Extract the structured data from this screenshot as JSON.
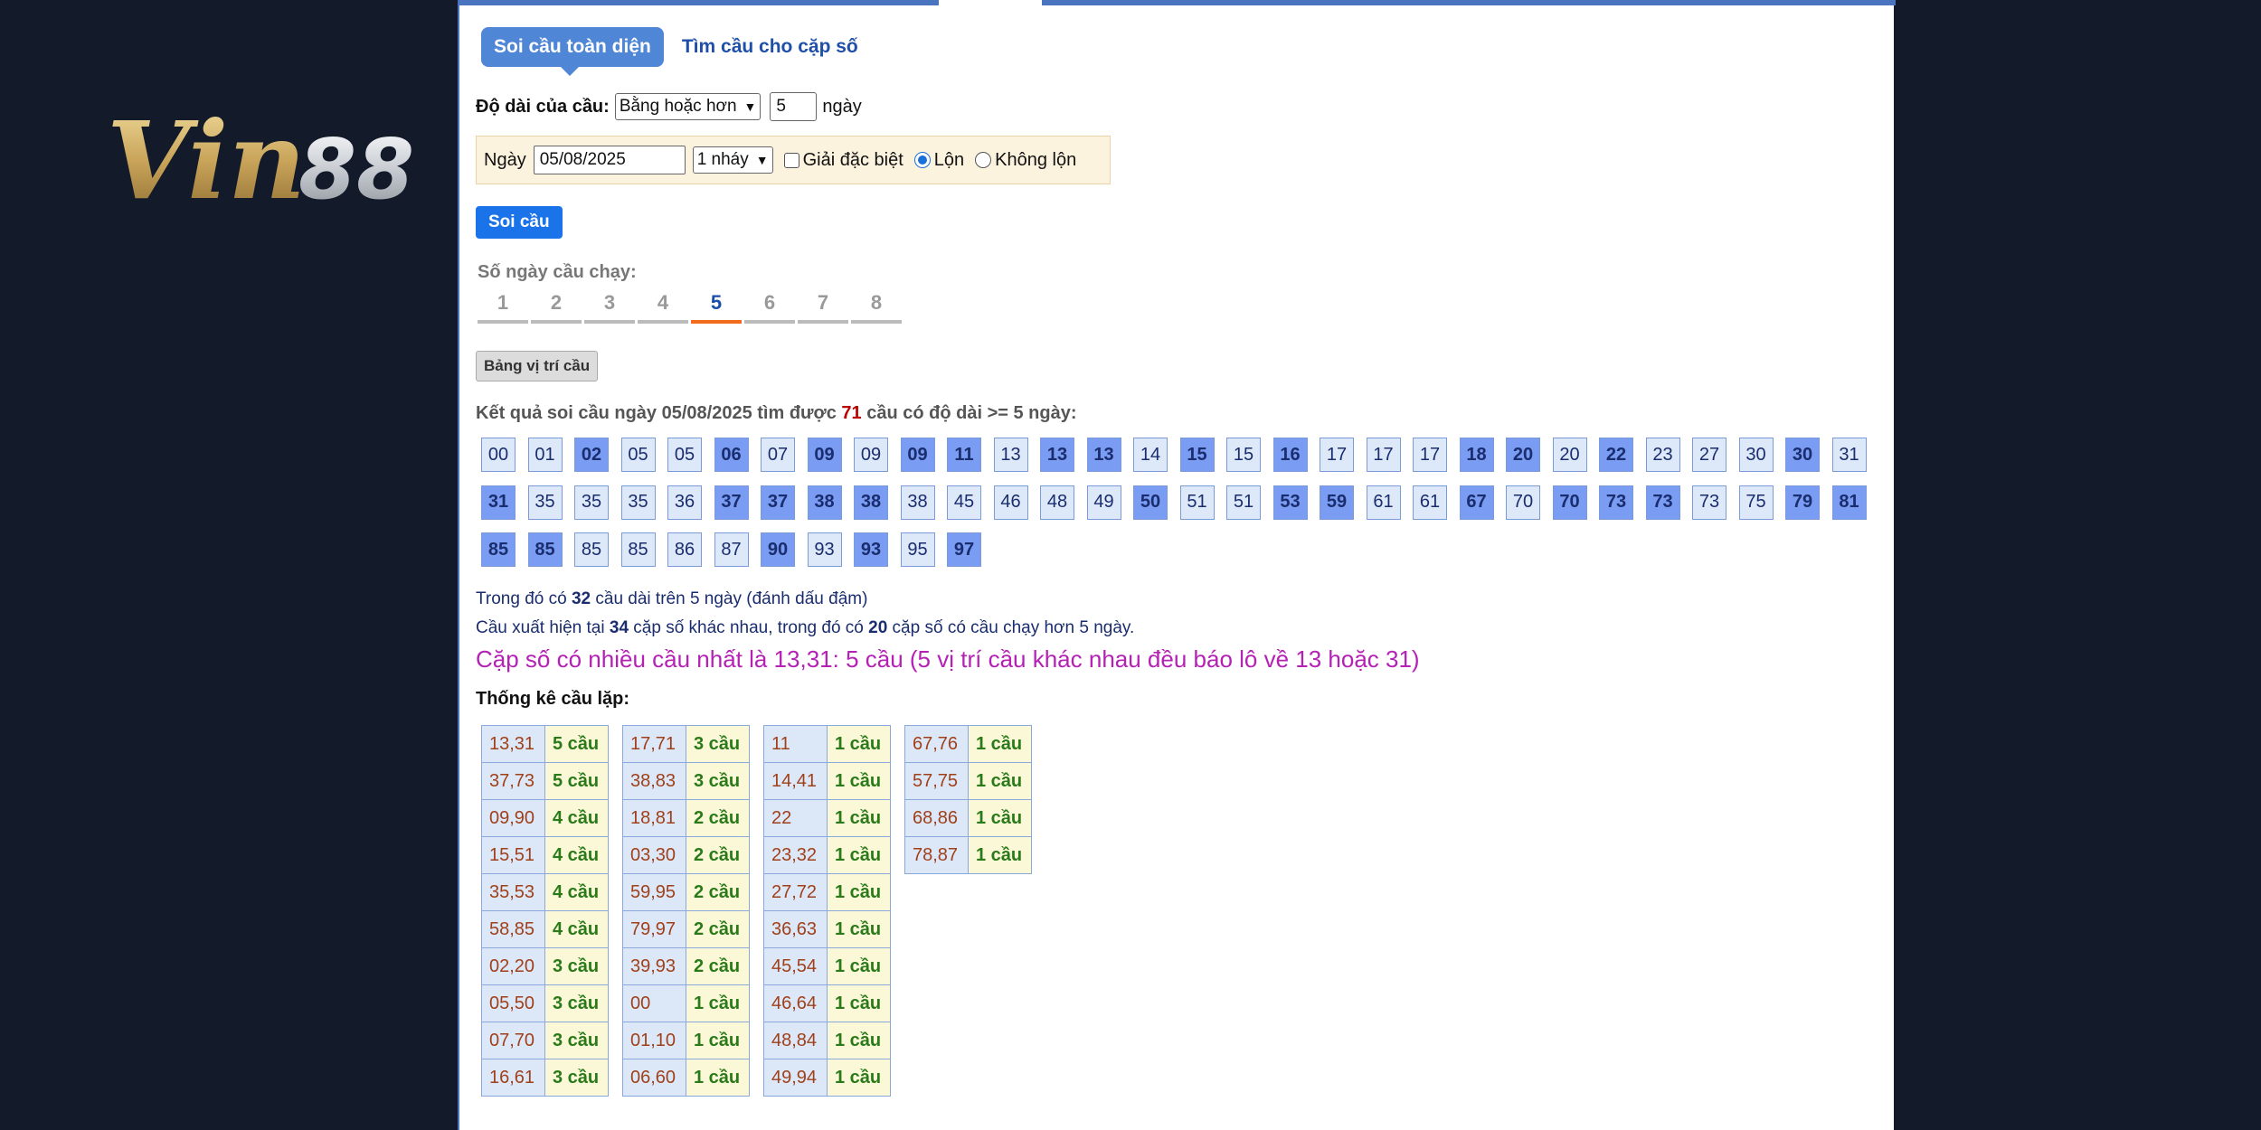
{
  "logo": {
    "text": "Vin88"
  },
  "tabs": {
    "active": "Soi cầu toàn diện",
    "other": "Tìm cầu cho cặp số"
  },
  "length_row": {
    "label": "Độ dài của cầu:",
    "select_value": "Bằng hoặc hơn",
    "days_value": "5",
    "unit": "ngày"
  },
  "filter": {
    "date_label": "Ngày",
    "date_value": "05/08/2025",
    "mode_value": "1 nháy",
    "special_label": "Giải đặc biệt",
    "lon_label": "Lộn",
    "khong_lon_label": "Không lộn"
  },
  "buttons": {
    "soi_cau": "Soi cầu",
    "bang_vi_tri": "Bảng vị trí cầu"
  },
  "days": {
    "label": "Số ngày cầu chạy:",
    "items": [
      "1",
      "2",
      "3",
      "4",
      "5",
      "6",
      "7",
      "8"
    ],
    "active": "5"
  },
  "result": {
    "prefix": "Kết quả soi cầu ngày 05/08/2025 tìm được ",
    "count": "71",
    "suffix": " cầu có độ dài >= 5 ngày:"
  },
  "numbers": [
    {
      "v": "00",
      "d": false
    },
    {
      "v": "01",
      "d": false
    },
    {
      "v": "02",
      "d": true
    },
    {
      "v": "05",
      "d": false
    },
    {
      "v": "05",
      "d": false
    },
    {
      "v": "06",
      "d": true
    },
    {
      "v": "07",
      "d": false
    },
    {
      "v": "09",
      "d": true
    },
    {
      "v": "09",
      "d": false
    },
    {
      "v": "09",
      "d": true
    },
    {
      "v": "11",
      "d": true
    },
    {
      "v": "13",
      "d": false
    },
    {
      "v": "13",
      "d": true
    },
    {
      "v": "13",
      "d": true
    },
    {
      "v": "14",
      "d": false
    },
    {
      "v": "15",
      "d": true
    },
    {
      "v": "15",
      "d": false
    },
    {
      "v": "16",
      "d": true
    },
    {
      "v": "17",
      "d": false
    },
    {
      "v": "17",
      "d": false
    },
    {
      "v": "17",
      "d": false
    },
    {
      "v": "18",
      "d": true
    },
    {
      "v": "20",
      "d": true
    },
    {
      "v": "20",
      "d": false
    },
    {
      "v": "22",
      "d": true
    },
    {
      "v": "23",
      "d": false
    },
    {
      "v": "27",
      "d": false
    },
    {
      "v": "30",
      "d": false
    },
    {
      "v": "30",
      "d": true
    },
    {
      "v": "31",
      "d": false
    },
    {
      "v": "31",
      "d": true
    },
    {
      "v": "35",
      "d": false
    },
    {
      "v": "35",
      "d": false
    },
    {
      "v": "35",
      "d": false
    },
    {
      "v": "36",
      "d": false
    },
    {
      "v": "37",
      "d": true
    },
    {
      "v": "37",
      "d": true
    },
    {
      "v": "38",
      "d": true
    },
    {
      "v": "38",
      "d": true
    },
    {
      "v": "38",
      "d": false
    },
    {
      "v": "45",
      "d": false
    },
    {
      "v": "46",
      "d": false
    },
    {
      "v": "48",
      "d": false
    },
    {
      "v": "49",
      "d": false
    },
    {
      "v": "50",
      "d": true
    },
    {
      "v": "51",
      "d": false
    },
    {
      "v": "51",
      "d": false
    },
    {
      "v": "53",
      "d": true
    },
    {
      "v": "59",
      "d": true
    },
    {
      "v": "61",
      "d": false
    },
    {
      "v": "61",
      "d": false
    },
    {
      "v": "67",
      "d": true
    },
    {
      "v": "70",
      "d": false
    },
    {
      "v": "70",
      "d": true
    },
    {
      "v": "73",
      "d": true
    },
    {
      "v": "73",
      "d": true
    },
    {
      "v": "73",
      "d": false
    },
    {
      "v": "75",
      "d": false
    },
    {
      "v": "79",
      "d": true
    },
    {
      "v": "81",
      "d": true
    },
    {
      "v": "85",
      "d": true
    },
    {
      "v": "85",
      "d": true
    },
    {
      "v": "85",
      "d": false
    },
    {
      "v": "85",
      "d": false
    },
    {
      "v": "86",
      "d": false
    },
    {
      "v": "87",
      "d": false
    },
    {
      "v": "90",
      "d": true
    },
    {
      "v": "93",
      "d": false
    },
    {
      "v": "93",
      "d": true
    },
    {
      "v": "95",
      "d": false
    },
    {
      "v": "97",
      "d": true
    }
  ],
  "info": {
    "line1_a": "Trong đó có ",
    "line1_b": "32",
    "line1_c": " cầu dài trên 5 ngày (đánh dấu đậm)",
    "line2_a": "Cầu xuất hiện tại ",
    "line2_b": "34",
    "line2_c": " cặp số khác nhau, trong đó có ",
    "line2_d": "20",
    "line2_e": " cặp số có cầu chạy hơn 5 ngày.",
    "highlight": "Cặp số có nhiều cầu nhất là 13,31: 5 cầu (5 vị trí cầu khác nhau đều báo lô về 13 hoặc 31)"
  },
  "stats": {
    "title": "Thống kê cầu lặp:",
    "columns": [
      [
        [
          "13,31",
          "5 cầu"
        ],
        [
          "37,73",
          "5 cầu"
        ],
        [
          "09,90",
          "4 cầu"
        ],
        [
          "15,51",
          "4 cầu"
        ],
        [
          "35,53",
          "4 cầu"
        ],
        [
          "58,85",
          "4 cầu"
        ],
        [
          "02,20",
          "3 cầu"
        ],
        [
          "05,50",
          "3 cầu"
        ],
        [
          "07,70",
          "3 cầu"
        ],
        [
          "16,61",
          "3 cầu"
        ]
      ],
      [
        [
          "17,71",
          "3 cầu"
        ],
        [
          "38,83",
          "3 cầu"
        ],
        [
          "18,81",
          "2 cầu"
        ],
        [
          "03,30",
          "2 cầu"
        ],
        [
          "59,95",
          "2 cầu"
        ],
        [
          "79,97",
          "2 cầu"
        ],
        [
          "39,93",
          "2 cầu"
        ],
        [
          "00",
          "1 cầu"
        ],
        [
          "01,10",
          "1 cầu"
        ],
        [
          "06,60",
          "1 cầu"
        ]
      ],
      [
        [
          "11",
          "1 cầu"
        ],
        [
          "14,41",
          "1 cầu"
        ],
        [
          "22",
          "1 cầu"
        ],
        [
          "23,32",
          "1 cầu"
        ],
        [
          "27,72",
          "1 cầu"
        ],
        [
          "36,63",
          "1 cầu"
        ],
        [
          "45,54",
          "1 cầu"
        ],
        [
          "46,64",
          "1 cầu"
        ],
        [
          "48,84",
          "1 cầu"
        ],
        [
          "49,94",
          "1 cầu"
        ]
      ],
      [
        [
          "67,76",
          "1 cầu"
        ],
        [
          "57,75",
          "1 cầu"
        ],
        [
          "68,86",
          "1 cầu"
        ],
        [
          "78,87",
          "1 cầu"
        ]
      ]
    ]
  },
  "colors": {
    "accent": "#4f86d6",
    "dark_cell": "#7a9cf2",
    "light_cell": "#dde8f8",
    "highlight": "#b521b5"
  }
}
